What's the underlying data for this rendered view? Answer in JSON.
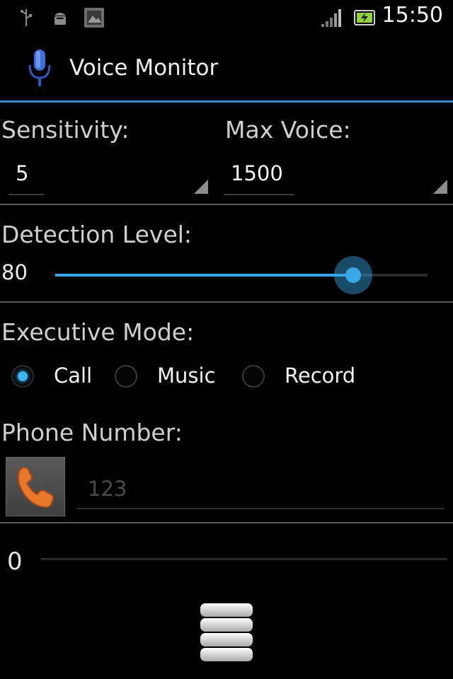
{
  "status_bar": {
    "time": "15:50",
    "icons": [
      "usb-icon",
      "android-debug-icon",
      "gallery-icon",
      "signal-icon",
      "battery-icon"
    ]
  },
  "app": {
    "title": "Voice Monitor",
    "icon": "microphone-icon",
    "accent": "#38a6e2"
  },
  "sensitivity": {
    "label": "Sensitivity:",
    "value": "5"
  },
  "max_voice": {
    "label": "Max Voice:",
    "value": "1500"
  },
  "detection": {
    "label": "Detection Level:",
    "value": "80",
    "fraction": 0.8
  },
  "executive_mode": {
    "label": "Executive Mode:",
    "options": [
      {
        "label": "Call",
        "checked": true
      },
      {
        "label": "Music",
        "checked": false
      },
      {
        "label": "Record",
        "checked": false
      }
    ]
  },
  "phone": {
    "label": "Phone Number:",
    "placeholder": "123",
    "button_icon": "phone-icon",
    "icon_color": "#e8782a"
  },
  "current_level": {
    "value": "0",
    "fraction": 0
  },
  "menu": {
    "icon": "menu-icon"
  }
}
